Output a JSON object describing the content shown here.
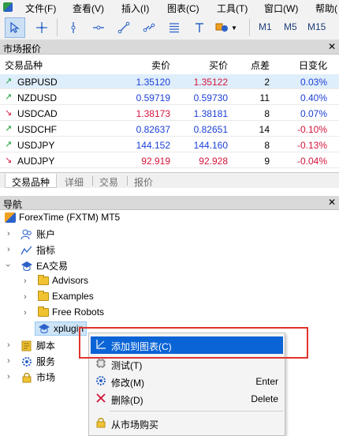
{
  "menubar": {
    "items": [
      "文件(F)",
      "查看(V)",
      "插入(I)",
      "图表(C)",
      "工具(T)",
      "窗口(W)",
      "帮助("
    ]
  },
  "toolbar": {
    "timeframes": [
      "M1",
      "M5",
      "M15"
    ]
  },
  "market_watch": {
    "title": "市场报价",
    "close_glyph": "✕",
    "columns": [
      "交易品种",
      "卖价",
      "买价",
      "点差",
      "日变化"
    ],
    "rows": [
      {
        "symbol": "GBPUSD",
        "bid": "1.35120",
        "ask": "1.35122",
        "spread": "2",
        "change": "0.03%",
        "dir": "up",
        "bid_color": "#1b3fd6",
        "ask_color": "#d4143a",
        "change_color": "#1b3fd6"
      },
      {
        "symbol": "NZDUSD",
        "bid": "0.59719",
        "ask": "0.59730",
        "spread": "11",
        "change": "0.40%",
        "dir": "up",
        "bid_color": "#1b3fd6",
        "ask_color": "#1b3fd6",
        "change_color": "#1b3fd6"
      },
      {
        "symbol": "USDCAD",
        "bid": "1.38173",
        "ask": "1.38181",
        "spread": "8",
        "change": "0.07%",
        "dir": "down",
        "bid_color": "#d4143a",
        "ask_color": "#1b3fd6",
        "change_color": "#1b3fd6"
      },
      {
        "symbol": "USDCHF",
        "bid": "0.82637",
        "ask": "0.82651",
        "spread": "14",
        "change": "-0.10%",
        "dir": "up",
        "bid_color": "#1b3fd6",
        "ask_color": "#1b3fd6",
        "change_color": "#d4143a"
      },
      {
        "symbol": "USDJPY",
        "bid": "144.152",
        "ask": "144.160",
        "spread": "8",
        "change": "-0.13%",
        "dir": "up",
        "bid_color": "#1b3fd6",
        "ask_color": "#1b3fd6",
        "change_color": "#d4143a"
      },
      {
        "symbol": "AUDJPY",
        "bid": "92.919",
        "ask": "92.928",
        "spread": "9",
        "change": "-0.04%",
        "dir": "down",
        "bid_color": "#d4143a",
        "ask_color": "#d4143a",
        "change_color": "#d4143a"
      }
    ],
    "tabs": [
      "交易品种",
      "详细",
      "交易",
      "报价"
    ]
  },
  "navigator": {
    "title": "导航",
    "close_glyph": "✕",
    "root": "ForexTime (FXTM) MT5",
    "accounts": "账户",
    "indicators": "指标",
    "expert_advisors": "EA交易",
    "folders": [
      "Advisors",
      "Examples",
      "Free Robots"
    ],
    "selected_item": "xplugin",
    "scripts": "脚本",
    "services": "服务",
    "market": "市场"
  },
  "context_menu": {
    "items": [
      {
        "label": "添加到图表(C)",
        "shortcut": "",
        "icon": "chart-icon"
      },
      {
        "label": "测试(T)",
        "shortcut": "",
        "icon": "test-icon"
      },
      {
        "label": "修改(M)",
        "shortcut": "Enter",
        "icon": "gear-icon"
      },
      {
        "label": "删除(D)",
        "shortcut": "Delete",
        "icon": "delete-icon"
      },
      {
        "label": "从市场购买",
        "shortcut": "",
        "icon": "lock-icon"
      }
    ]
  },
  "colors": {
    "up": "#1a9b3c",
    "down": "#d4143a",
    "highlight": "#0a64d6",
    "annotation": "#e0342c"
  }
}
